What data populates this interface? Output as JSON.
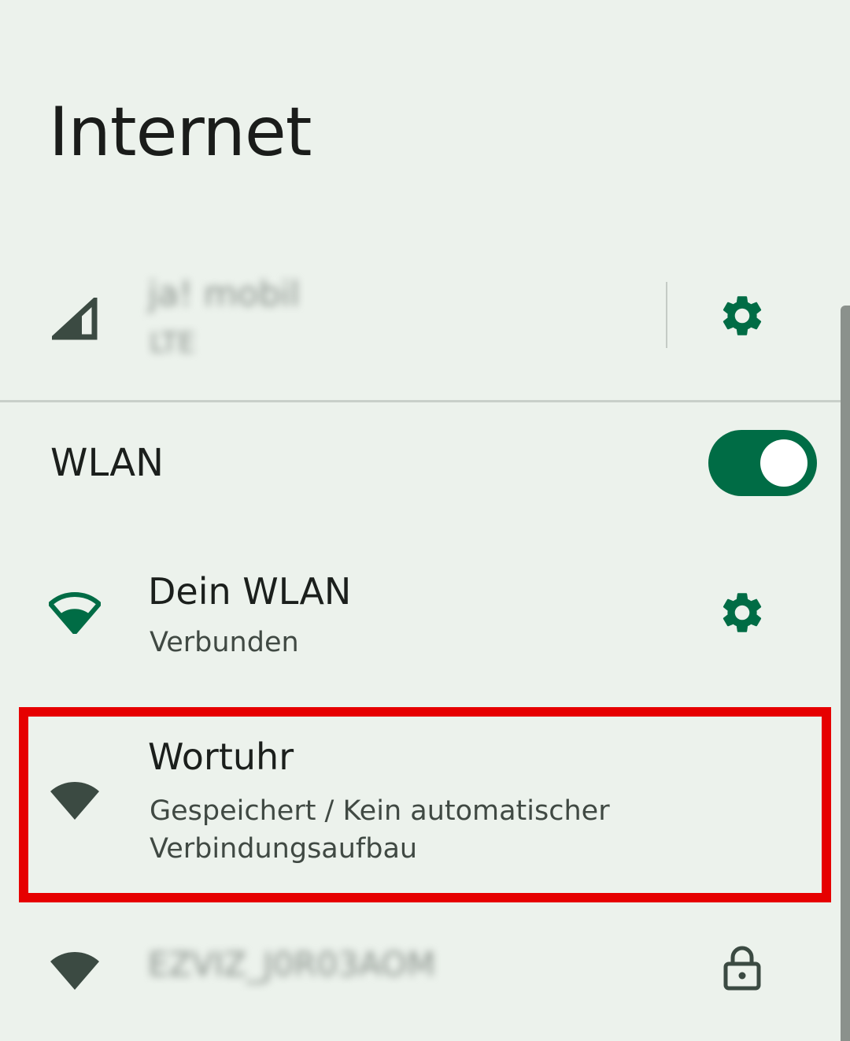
{
  "header": {
    "title": "Internet"
  },
  "mobile": {
    "carrier": "ja! mobil",
    "status": "LTE",
    "icon": "cellular-signal-icon",
    "settings_icon": "gear-icon"
  },
  "wlan": {
    "label": "WLAN",
    "enabled": true
  },
  "networks": [
    {
      "name": "Dein WLAN",
      "status": "Verbunden",
      "icon": "wifi-connected-icon",
      "settings_icon": "gear-icon"
    },
    {
      "name": "Wortuhr",
      "status_line1": "Gespeichert / Kein automatischer",
      "status_line2": "Verbindungsaufbau",
      "icon": "wifi-icon",
      "highlighted": true
    },
    {
      "name": "EZVIZ_J0R03AOM",
      "icon": "wifi-icon",
      "secured_icon": "lock-icon"
    }
  ],
  "colors": {
    "accent": "#006c45",
    "background": "#ecf2ec",
    "highlight_border": "#e60000",
    "icon_dark": "#3b4a42"
  }
}
